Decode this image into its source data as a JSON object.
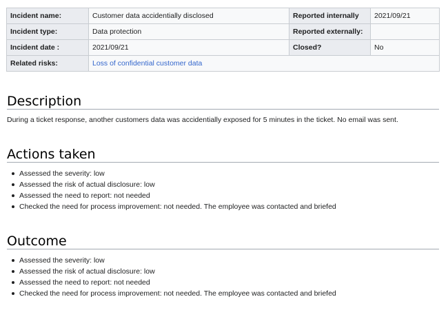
{
  "incident": {
    "rows": [
      {
        "label1": "Incident name:",
        "value1": "Customer data accidentially disclosed",
        "label2": "Reported internally",
        "value2": "2021/09/21"
      },
      {
        "label1": "Incident type:",
        "value1": "Data protection",
        "label2": "Reported externally:",
        "value2": ""
      },
      {
        "label1": "Incident date :",
        "value1": "2021/09/21",
        "label2": "Closed?",
        "value2": "No"
      }
    ],
    "related_risks_label": "Related risks:",
    "related_risks_link": "Loss of confidential customer data"
  },
  "description": {
    "heading": "Description",
    "text": "During a ticket response, another customers data was accidentially exposed for 5 minutes in the ticket. No email was sent."
  },
  "actions": {
    "heading": "Actions taken",
    "items": [
      "Assessed the severity: low",
      "Assessed the risk of actual disclosure: low",
      "Assessed the need to report: not needed",
      "Checked the need for process improvement: not needed. The employee was contacted and briefed"
    ]
  },
  "outcome": {
    "heading": "Outcome",
    "items": [
      "Assessed the severity: low",
      "Assessed the risk of actual disclosure: low",
      "Assessed the need to report: not needed",
      "Checked the need for process improvement: not needed. The employee was contacted and briefed"
    ]
  },
  "colors": {
    "link": "#3366cc",
    "label_bg": "#eaecf0",
    "value_bg": "#f8f9fa",
    "border": "#c8ccd1"
  }
}
